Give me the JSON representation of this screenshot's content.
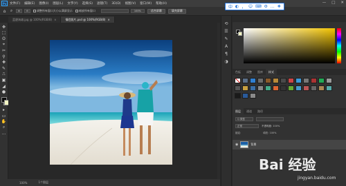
{
  "app": {
    "logo": "Ps"
  },
  "menubar": {
    "items": [
      "文件(F)",
      "编辑(E)",
      "图像(I)",
      "图层(L)",
      "文字(Y)",
      "选择(S)",
      "滤镜(T)",
      "3D(D)",
      "视图(V)",
      "窗口(W)",
      "帮助(H)"
    ]
  },
  "window_controls": {
    "minimize": "—",
    "maximize": "□",
    "close": "✕"
  },
  "options": {
    "check1": "调整所有窗口大小以满屏显示",
    "check2": "缩放所有窗口",
    "zoom": "100%",
    "fit_screen": "适合屏幕",
    "fill_screen": "填充屏幕"
  },
  "widget_icons": [
    "中",
    "◐",
    "，",
    "☺",
    "⌨",
    "⚙",
    "…",
    "❖"
  ],
  "tabs": [
    {
      "label": "蓝碧海滩.jpg @ 100%(RGB/8)",
      "active": false
    },
    {
      "label": "情侣照片.psd @ 100%(RGB/8)",
      "active": true
    }
  ],
  "tools": [
    "✥",
    "⬚",
    "ʘ",
    "⌖",
    "✂",
    "⚲",
    "✚",
    "✎",
    "⎍",
    "▣",
    "◢",
    "●",
    "✒",
    "T",
    "▸",
    "▭",
    "✋",
    "⌕",
    "…"
  ],
  "status": {
    "zoom": "100%",
    "doc": "1个图层"
  },
  "panel": {
    "swatch_tabs": [
      "色板",
      "调整",
      "图库",
      "样式"
    ],
    "layer_tabs": [
      "图层",
      "通道",
      "路径"
    ],
    "filter_label": "Q 类型",
    "blend_mode": "正常",
    "opacity": "不透明度: 100%",
    "lock": "锁定:",
    "fill": "填充: 100%",
    "layer_name": "背景"
  },
  "watermark": {
    "text": "Bai 经验",
    "sub": "jingyan.baidu.com"
  },
  "colors": {
    "accent": "#31a8ff",
    "widget_blue": "#1e6fd9",
    "fg": "#000000",
    "bg": "#f3f5c3"
  }
}
